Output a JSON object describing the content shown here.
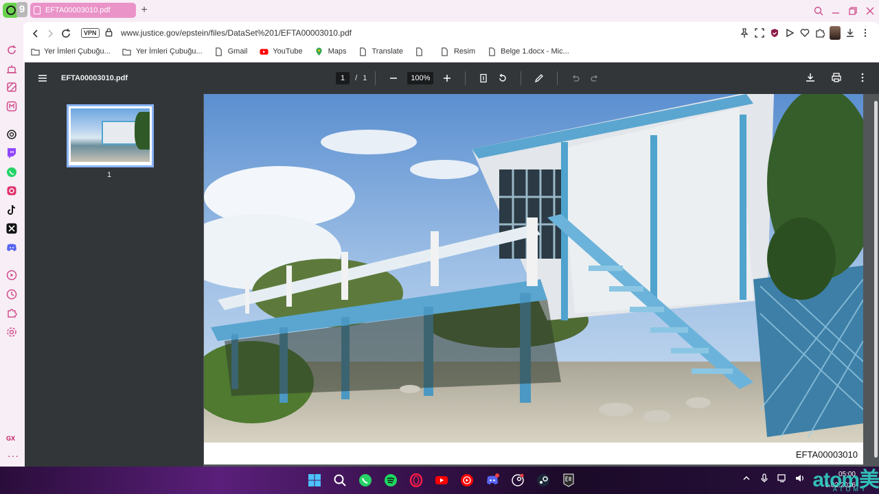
{
  "browser": {
    "badge_count": "9",
    "tab_title": "EFTA00003010.pdf",
    "new_tab": "+",
    "vpn_label": "VPN",
    "url": "www.justice.gov/epstein/files/DataSet%201/EFTA00003010.pdf"
  },
  "bookmarks": [
    {
      "label": "Yer İmleri Çubuğu...",
      "icon": "folder-icon"
    },
    {
      "label": "Yer İmleri Çubuğu...",
      "icon": "folder-icon"
    },
    {
      "label": "Gmail",
      "icon": "doc-icon"
    },
    {
      "label": "YouTube",
      "icon": "youtube-icon"
    },
    {
      "label": "Maps",
      "icon": "maps-icon"
    },
    {
      "label": "Translate",
      "icon": "doc-icon"
    },
    {
      "label": "",
      "icon": "doc-icon"
    },
    {
      "label": "Resim",
      "icon": "doc-icon"
    },
    {
      "label": "Belge 1.docx - Mic...",
      "icon": "doc-icon"
    }
  ],
  "sidebar": {
    "gx_label": "GX",
    "more_label": "···"
  },
  "pdf": {
    "file_name": "EFTA00003010.pdf",
    "current_page": "1",
    "page_sep": "/",
    "total_pages": "1",
    "zoom": "100%",
    "thumbnail_label": "1",
    "page_code": "EFTA00003010"
  },
  "taskbar": {
    "time": "05:00",
    "date": "6.02.2026",
    "watermark": "atom美",
    "watermark_sub": "ATOMY"
  },
  "colors": {
    "accent": "#d04a8a",
    "tab": "#ea93c9",
    "pdf_toolbar": "#323639",
    "thumb_border": "#8ab4f8"
  }
}
